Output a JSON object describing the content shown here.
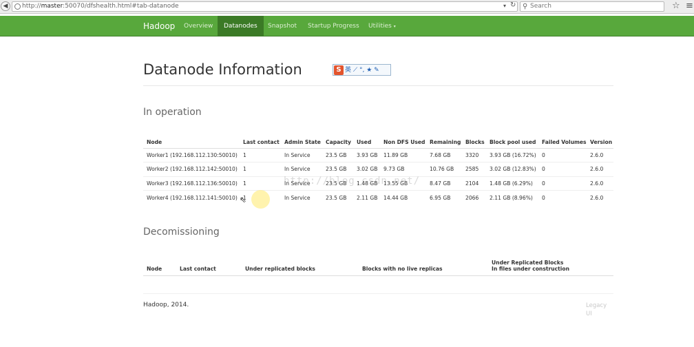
{
  "browser": {
    "url_prefix": "http://",
    "url_host": "master",
    "url_rest": ":50070/dfshealth.html#tab-datanode",
    "search_placeholder": "Search"
  },
  "navbar": {
    "brand": "Hadoop",
    "links": [
      "Overview",
      "Datanodes",
      "Snapshot",
      "Startup Progress",
      "Utilities"
    ],
    "active": "Datanodes",
    "color": "#58a83c"
  },
  "page": {
    "title": "Datanode Information",
    "ime_logo": "S",
    "ime_rest": "英 ⟋ °, ★ ✎",
    "section_operation": "In operation",
    "section_decom": "Decomissioning",
    "footer": "Hadoop, 2014.",
    "legacy_line1": "Legacy",
    "legacy_line2": "UI",
    "watermark": "http://blog.csdn.net/"
  },
  "datanodes": {
    "headers": [
      "Node",
      "Last contact",
      "Admin State",
      "Capacity",
      "Used",
      "Non DFS Used",
      "Remaining",
      "Blocks",
      "Block pool used",
      "Failed Volumes",
      "Version"
    ],
    "rows": [
      [
        "Worker1 (192.168.112.130:50010)",
        "1",
        "In Service",
        "23.5 GB",
        "3.93 GB",
        "11.89 GB",
        "7.68 GB",
        "3320",
        "3.93 GB (16.72%)",
        "0",
        "2.6.0"
      ],
      [
        "Worker2 (192.168.112.142:50010)",
        "1",
        "In Service",
        "23.5 GB",
        "3.02 GB",
        "9.73 GB",
        "10.76 GB",
        "2585",
        "3.02 GB (12.83%)",
        "0",
        "2.6.0"
      ],
      [
        "Worker3 (192.168.112.136:50010)",
        "1",
        "In Service",
        "23.5 GB",
        "1.48 GB",
        "13.55 GB",
        "8.47 GB",
        "2104",
        "1.48 GB (6.29%)",
        "0",
        "2.6.0"
      ],
      [
        "Worker4 (192.168.112.141:50010)",
        "1",
        "In Service",
        "23.5 GB",
        "2.11 GB",
        "14.44 GB",
        "6.95 GB",
        "2066",
        "2.11 GB (8.96%)",
        "0",
        "2.6.0"
      ]
    ]
  },
  "decom": {
    "headers": [
      "Node",
      "Last contact",
      "Under replicated blocks",
      "Blocks with no live replicas",
      "Under Replicated Blocks\nIn files under construction"
    ]
  }
}
